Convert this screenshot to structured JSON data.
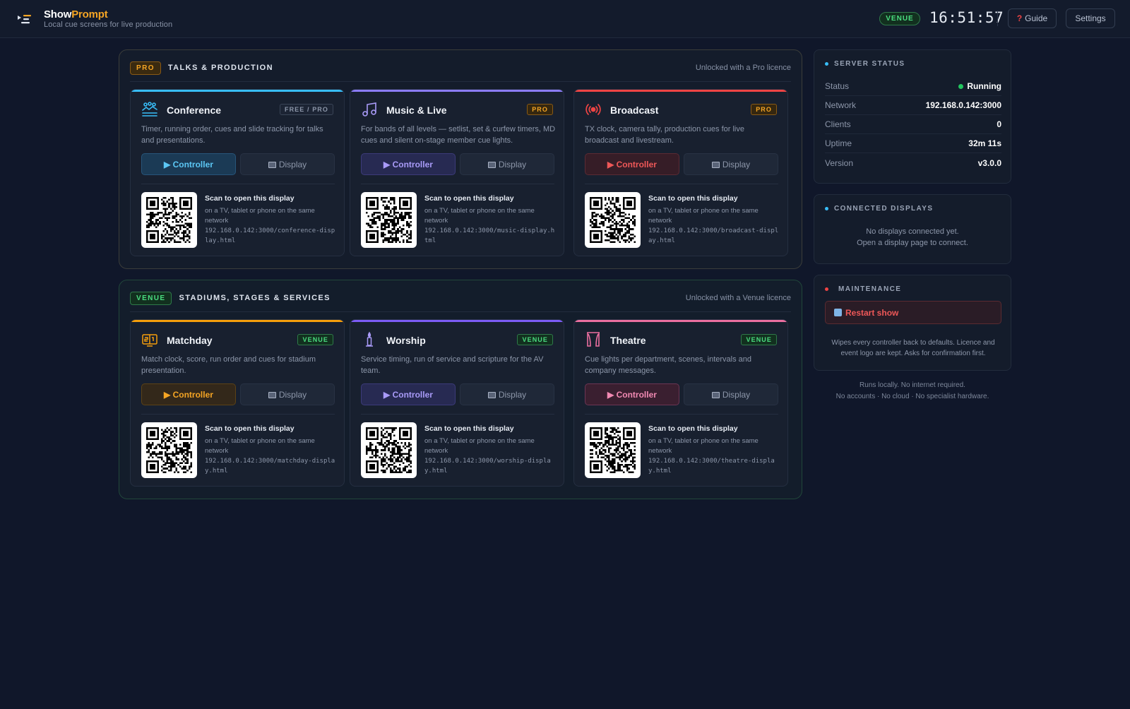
{
  "header": {
    "brand_part1": "Show",
    "brand_part2": "Prompt",
    "tagline": "Local cue screens for live production",
    "licence_badge": "VENUE",
    "clock": "16:51:57",
    "guide_label": "Guide",
    "guide_glyph": "?",
    "settings_label": "Settings"
  },
  "groups": [
    {
      "badge": "PRO",
      "title": "TALKS & PRODUCTION",
      "note": "Unlocked with a Pro licence",
      "cards": [
        {
          "title": "Conference",
          "tier": "FREE / PRO",
          "icon": "audience-icon",
          "accent": "#38bdf8",
          "description": "Timer, running order, cues and slide tracking for talks and presentations.",
          "controller_label": "Controller",
          "display_label": "Display",
          "scan_title": "Scan to open this display",
          "scan_sub": "on a TV, tablet or phone on the same network",
          "url": "192.168.0.142:3000/conference-display.html"
        },
        {
          "title": "Music & Live",
          "tier": "PRO",
          "icon": "music-note-icon",
          "accent": "#8b7cf6",
          "description": "For bands of all levels — setlist, set & curfew timers, MD cues and silent on-stage member cue lights.",
          "controller_label": "Controller",
          "display_label": "Display",
          "scan_title": "Scan to open this display",
          "scan_sub": "on a TV, tablet or phone on the same network",
          "url": "192.168.0.142:3000/music-display.html"
        },
        {
          "title": "Broadcast",
          "tier": "PRO",
          "icon": "broadcast-icon",
          "accent": "#ef4444",
          "description": "TX clock, camera tally, production cues for live broadcast and livestream.",
          "controller_label": "Controller",
          "display_label": "Display",
          "scan_title": "Scan to open this display",
          "scan_sub": "on a TV, tablet or phone on the same network",
          "url": "192.168.0.142:3000/broadcast-display.html"
        }
      ]
    },
    {
      "badge": "VENUE",
      "title": "STADIUMS, STAGES & SERVICES",
      "note": "Unlocked with a Venue licence",
      "cards": [
        {
          "title": "Matchday",
          "tier": "VENUE",
          "icon": "scoreboard-icon",
          "accent": "#f59e0b",
          "description": "Match clock, score, run order and cues for stadium presentation.",
          "controller_label": "Controller",
          "display_label": "Display",
          "scan_title": "Scan to open this display",
          "scan_sub": "on a TV, tablet or phone on the same network",
          "url": "192.168.0.142:3000/matchday-display.html"
        },
        {
          "title": "Worship",
          "tier": "VENUE",
          "icon": "candle-icon",
          "accent": "#7c5cf6",
          "description": "Service timing, run of service and scripture for the AV team.",
          "controller_label": "Controller",
          "display_label": "Display",
          "scan_title": "Scan to open this display",
          "scan_sub": "on a TV, tablet or phone on the same network",
          "url": "192.168.0.142:3000/worship-display.html"
        },
        {
          "title": "Theatre",
          "tier": "VENUE",
          "icon": "stage-curtain-icon",
          "accent": "#ec6fa0",
          "description": "Cue lights per department, scenes, intervals and company messages.",
          "controller_label": "Controller",
          "display_label": "Display",
          "scan_title": "Scan to open this display",
          "scan_sub": "on a TV, tablet or phone on the same network",
          "url": "192.168.0.142:3000/theatre-display.html"
        }
      ]
    }
  ],
  "server_status": {
    "title": "SERVER STATUS",
    "rows": [
      {
        "label": "Status",
        "value": "Running"
      },
      {
        "label": "Network",
        "value": "192.168.0.142:3000"
      },
      {
        "label": "Clients",
        "value": "0"
      },
      {
        "label": "Uptime",
        "value": "32m 11s"
      },
      {
        "label": "Version",
        "value": "v3.0.0"
      }
    ]
  },
  "connected_displays": {
    "title": "CONNECTED DISPLAYS",
    "empty_line1": "No displays connected yet.",
    "empty_line2": "Open a display page to connect."
  },
  "maintenance": {
    "title": "MAINTENANCE",
    "restart_label": "Restart show",
    "note": "Wipes every controller back to defaults. Licence and event logo are kept. Asks for confirmation first."
  },
  "footer": {
    "line1": "Runs locally. No internet required.",
    "line2": "No accounts · No cloud · No specialist hardware."
  },
  "colors": {
    "background": "#10172a",
    "brand_accent": "#f5a524",
    "venue_green": "#4ade80",
    "danger": "#ef4444",
    "status_running": "#22c55e"
  }
}
